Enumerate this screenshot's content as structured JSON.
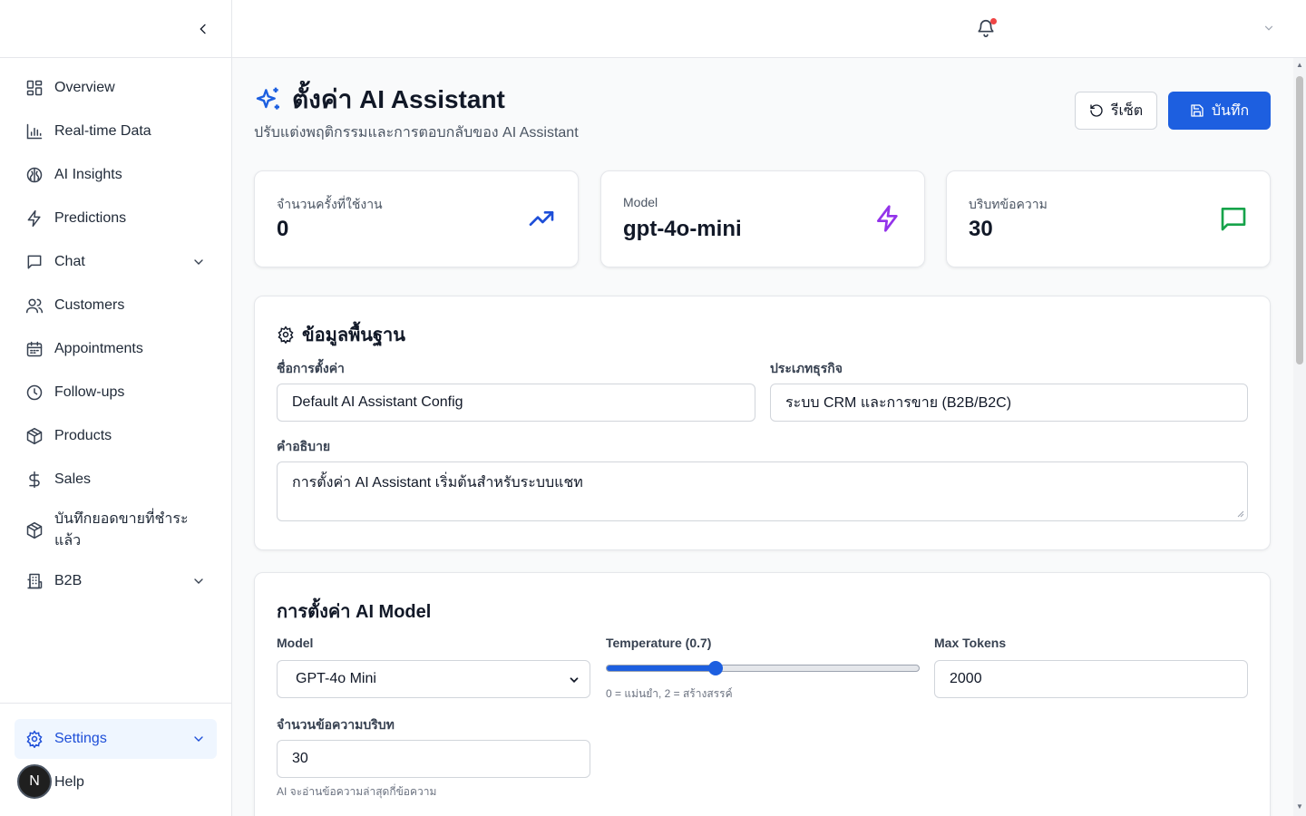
{
  "sidebar": {
    "items": [
      {
        "label": "Overview",
        "icon": "grid-icon"
      },
      {
        "label": "Real-time Data",
        "icon": "bar-chart-icon"
      },
      {
        "label": "AI Insights",
        "icon": "brain-icon"
      },
      {
        "label": "Predictions",
        "icon": "lightning-icon"
      },
      {
        "label": "Chat",
        "icon": "message-square-icon"
      },
      {
        "label": "Customers",
        "icon": "users-icon"
      },
      {
        "label": "Appointments",
        "icon": "calendar-icon"
      },
      {
        "label": "Follow-ups",
        "icon": "clock-icon"
      },
      {
        "label": "Products",
        "icon": "box-icon"
      },
      {
        "label": "Sales",
        "icon": "dollar-icon"
      },
      {
        "label": "บันทึกยอดขายที่ชำระแล้ว",
        "icon": "box-icon"
      },
      {
        "label": "B2B",
        "icon": "building-icon"
      }
    ],
    "settings_label": "Settings",
    "help_label": "Help",
    "avatar_initial": "N"
  },
  "page": {
    "title": "ตั้งค่า AI Assistant",
    "subtitle": "ปรับแต่งพฤติกรรมและการตอบกลับของ AI Assistant",
    "reset_label": "รีเซ็ต",
    "save_label": "บันทึก"
  },
  "stats": [
    {
      "label": "จำนวนครั้งที่ใช้งาน",
      "value": "0",
      "icon": "trending-up-icon",
      "color": "#1d4ed8"
    },
    {
      "label": "Model",
      "value": "gpt-4o-mini",
      "icon": "lightning-icon",
      "color": "#9333ea"
    },
    {
      "label": "บริบทข้อความ",
      "value": "30",
      "icon": "message-square-icon",
      "color": "#16a34a"
    }
  ],
  "basic": {
    "title": "ข้อมูลพื้นฐาน",
    "name_label": "ชื่อการตั้งค่า",
    "name_value": "Default AI Assistant Config",
    "business_label": "ประเภทธุรกิจ",
    "business_value": "ระบบ CRM และการขาย (B2B/B2C)",
    "desc_label": "คำอธิบาย",
    "desc_value": "การตั้งค่า AI Assistant เริ่มต้นสำหรับระบบแชท"
  },
  "model_cfg": {
    "title": "การตั้งค่า AI Model",
    "model_label": "Model",
    "model_value": "GPT-4o Mini",
    "temp_label": "Temperature (0.7)",
    "temp_value": 0.35,
    "temp_hint": "0 = แม่นยำ, 2 = สร้างสรรค์",
    "tokens_label": "Max Tokens",
    "tokens_value": "2000",
    "context_label": "จำนวนข้อความบริบท",
    "context_value": "30",
    "context_hint": "AI จะอ่านข้อความล่าสุดกี่ข้อความ"
  },
  "colors": {
    "primary": "#1d5fe0",
    "accent_purple": "#9333ea",
    "accent_green": "#16a34a",
    "notification": "#ef4444"
  }
}
